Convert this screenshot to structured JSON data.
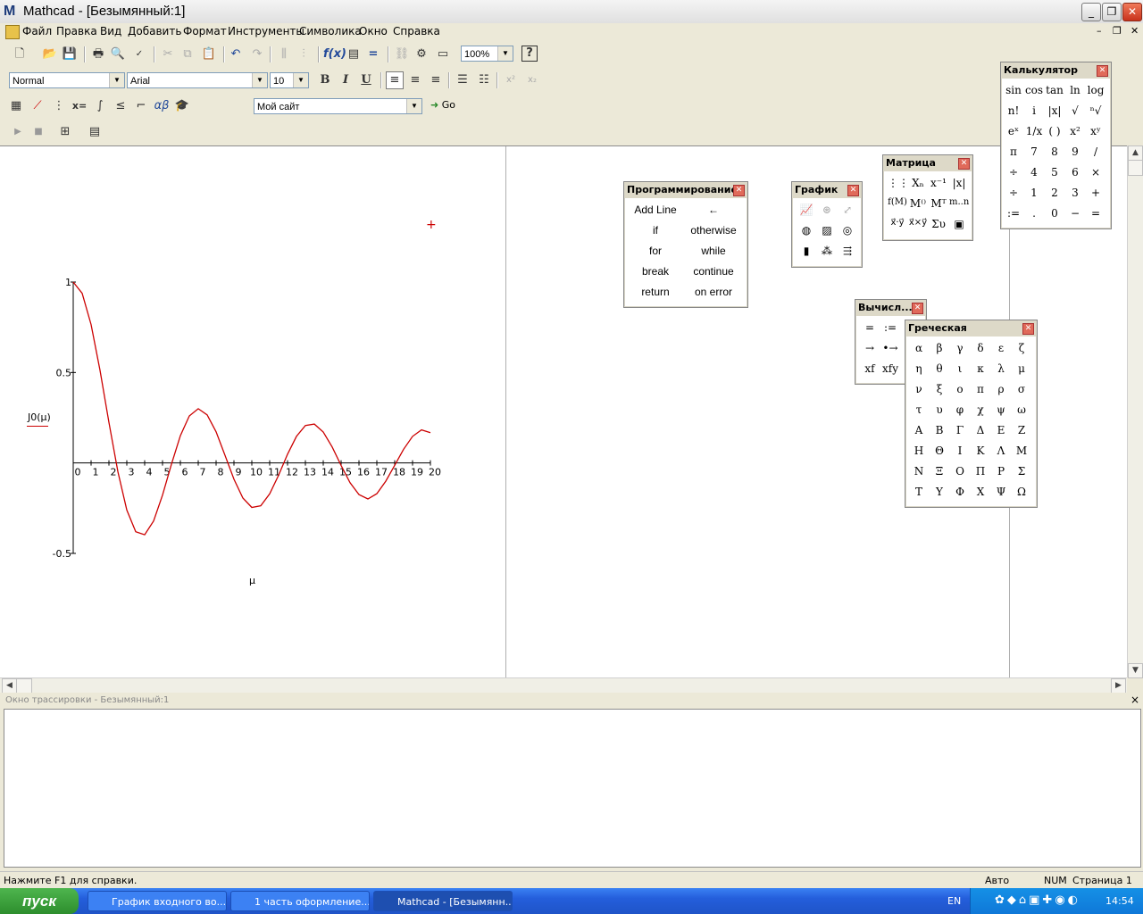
{
  "app": {
    "title": "Mathcad - [Безымянный:1]",
    "logo": "M"
  },
  "menu": [
    "Файл",
    "Правка",
    "Вид",
    "Добавить",
    "Формат",
    "Инструменты",
    "Символика",
    "Окно",
    "Справка"
  ],
  "toolbar": {
    "zoom": "100%",
    "style": "Normal",
    "font": "Arial",
    "size": "10",
    "bold": "B",
    "italic": "I",
    "underline": "U",
    "site": "Мой сайт",
    "go": "Go"
  },
  "chart_data": {
    "type": "line",
    "ylabel": "J0(μ)",
    "xlabel": "μ",
    "xlim": [
      0,
      20
    ],
    "ylim": [
      -0.5,
      1
    ],
    "x_ticks": [
      "0",
      "1",
      "2",
      "3",
      "4",
      "5",
      "6",
      "7",
      "8",
      "9",
      "10",
      "11",
      "12",
      "13",
      "14",
      "15",
      "16",
      "17",
      "18",
      "19",
      "20"
    ],
    "y_ticks": [
      "1",
      "0.5",
      "-0.5"
    ],
    "series": [
      {
        "x": [
          0,
          0.5,
          1,
          1.5,
          2,
          2.5,
          3,
          3.5,
          4,
          4.5,
          5,
          5.5,
          6,
          6.5,
          7,
          7.5,
          8,
          8.5,
          9,
          9.5,
          10,
          10.5,
          11,
          11.5,
          12,
          12.5,
          13,
          13.5,
          14,
          14.5,
          15,
          15.5,
          16,
          16.5,
          17,
          17.5,
          18,
          18.5,
          19,
          19.5,
          20
        ],
        "y": [
          1,
          0.938,
          0.765,
          0.512,
          0.224,
          -0.048,
          -0.26,
          -0.38,
          -0.397,
          -0.321,
          -0.178,
          -0.007,
          0.151,
          0.26,
          0.3,
          0.266,
          0.172,
          0.042,
          -0.09,
          -0.194,
          -0.246,
          -0.237,
          -0.171,
          -0.068,
          0.048,
          0.147,
          0.207,
          0.215,
          0.171,
          0.088,
          -0.014,
          -0.109,
          -0.175,
          -0.199,
          -0.17,
          -0.101,
          -0.013,
          0.076,
          0.147,
          0.183,
          0.167
        ],
        "color": "#cc0000"
      }
    ]
  },
  "palettes": {
    "programming": {
      "title": "Программирование",
      "items": [
        "Add Line",
        "←",
        "if",
        "otherwise",
        "for",
        "while",
        "break",
        "continue",
        "return",
        "on error"
      ]
    },
    "graph": {
      "title": "График"
    },
    "matrix": {
      "title": "Матрица"
    },
    "calculator": {
      "title": "Калькулятор",
      "items": [
        "sin",
        "cos",
        "tan",
        "ln",
        "log",
        "n!",
        "i",
        "|x|",
        "√",
        "ⁿ√",
        "eˣ",
        "1/x",
        "( )",
        "x²",
        "xʸ",
        "π",
        "7",
        "8",
        "9",
        "/",
        "÷",
        "4",
        "5",
        "6",
        "×",
        "÷",
        "1",
        "2",
        "3",
        "+",
        ":=",
        ".",
        "0",
        "−",
        "="
      ]
    },
    "evaluation": {
      "title": "Вычисл...",
      "items": [
        "=",
        ":=",
        "→",
        "•→",
        "xf",
        "xfy"
      ]
    },
    "greek": {
      "title": "Греческая",
      "items": [
        "α",
        "β",
        "γ",
        "δ",
        "ε",
        "ζ",
        "η",
        "θ",
        "ι",
        "κ",
        "λ",
        "μ",
        "ν",
        "ξ",
        "ο",
        "π",
        "ρ",
        "σ",
        "τ",
        "υ",
        "φ",
        "χ",
        "ψ",
        "ω",
        "Α",
        "Β",
        "Γ",
        "Δ",
        "Ε",
        "Ζ",
        "Η",
        "Θ",
        "Ι",
        "Κ",
        "Λ",
        "Μ",
        "Ν",
        "Ξ",
        "Ο",
        "Π",
        "Ρ",
        "Σ",
        "Τ",
        "Υ",
        "Φ",
        "Χ",
        "Ψ",
        "Ω"
      ]
    }
  },
  "trace": {
    "title": "Окно трассировки - Безымянный:1",
    "close": "×"
  },
  "status": {
    "help": "Нажмите F1 для справки.",
    "mode": "Авто",
    "num": "NUM",
    "page": "Страница 1"
  },
  "taskbar": {
    "start": "пуск",
    "tasks": [
      "График входного во...",
      "1 часть оформление...",
      "Mathcad - [Безымянн..."
    ],
    "lang": "EN",
    "time": "14:54"
  }
}
